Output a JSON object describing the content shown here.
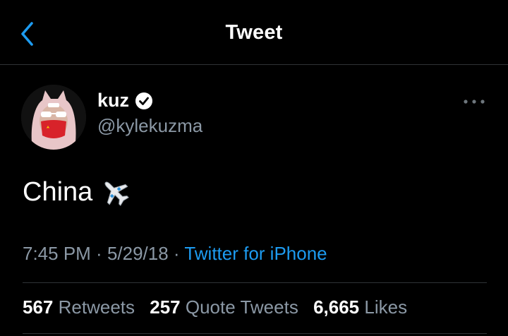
{
  "header": {
    "title": "Tweet",
    "back_icon": "chevron-left-icon"
  },
  "tweet": {
    "author": {
      "name": "kuz",
      "handle": "@kylekuzma",
      "verified": true,
      "avatar": "avatar"
    },
    "more_icon": "more-horizontal-icon",
    "text": "China",
    "emoji": "airplane-emoji",
    "time": "7:45 PM",
    "separator1": " · ",
    "date": "5/29/18",
    "separator2": " · ",
    "source": "Twitter for iPhone",
    "stats": {
      "retweets_count": "567",
      "retweets_label": "Retweets",
      "quotes_count": "257",
      "quotes_label": "Quote Tweets",
      "likes_count": "6,665",
      "likes_label": "Likes"
    }
  },
  "colors": {
    "background": "#000000",
    "accent": "#1d9bf0",
    "secondary_text": "#8b98a5",
    "divider": "#2f3336"
  }
}
